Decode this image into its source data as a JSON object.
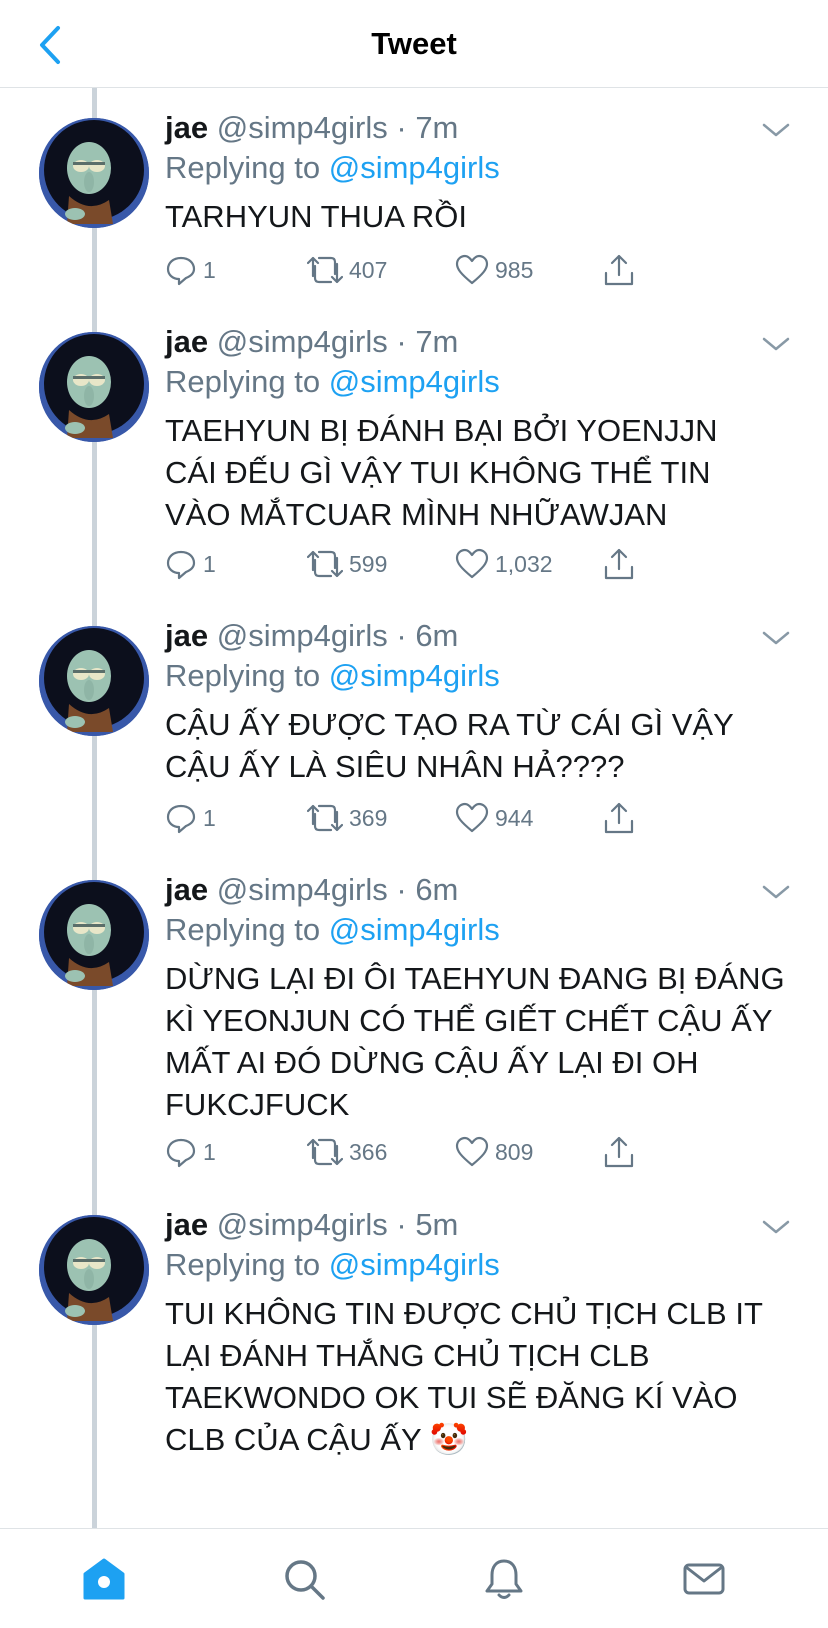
{
  "header": {
    "title": "Tweet"
  },
  "tweets": [
    {
      "name": "jae",
      "handle": "@simp4girls",
      "dot": "·",
      "time": "7m",
      "replying_prefix": "Replying to",
      "replying_to": "@simp4girls",
      "text_lines": [
        "TARHYUN THUA RỒI"
      ],
      "replies": "1",
      "retweets": "407",
      "likes": "985"
    },
    {
      "name": "jae",
      "handle": "@simp4girls",
      "dot": "·",
      "time": "7m",
      "replying_prefix": "Replying to",
      "replying_to": "@simp4girls",
      "text_lines": [
        "TAEHYUN BỊ ĐÁNH BẠI BỞI YOENJJN",
        "CÁI ĐẾU GÌ VẬY TUI KHÔNG THỂ TIN",
        "VÀO MẮTCUAR MÌNH NHỮAWJAN"
      ],
      "replies": "1",
      "retweets": "599",
      "likes": "1,032"
    },
    {
      "name": "jae",
      "handle": "@simp4girls",
      "dot": "·",
      "time": "6m",
      "replying_prefix": "Replying to",
      "replying_to": "@simp4girls",
      "text_lines": [
        "CẬU ẤY ĐƯỢC TẠO RA TỪ CÁI GÌ VẬY",
        "CẬU ẤY LÀ SIÊU NHÂN HẢ????"
      ],
      "replies": "1",
      "retweets": "369",
      "likes": "944"
    },
    {
      "name": "jae",
      "handle": "@simp4girls",
      "dot": "·",
      "time": "6m",
      "replying_prefix": "Replying to",
      "replying_to": "@simp4girls",
      "text_lines": [
        "DỪNG LẠI ĐI ÔI TAEHYUN ĐANG BỊ ĐÁNG",
        "KÌ YEONJUN CÓ THỂ GIẾT CHẾT CẬU ẤY",
        "MẤT AI ĐÓ DỪNG CẬU ẤY LẠI ĐI OH",
        "FUKCJFUCK"
      ],
      "replies": "1",
      "retweets": "366",
      "likes": "809"
    },
    {
      "name": "jae",
      "handle": "@simp4girls",
      "dot": "·",
      "time": "5m",
      "replying_prefix": "Replying to",
      "replying_to": "@simp4girls",
      "text_lines": [
        "TUI KHÔNG TIN ĐƯỢC CHỦ TỊCH CLB IT",
        "LẠI ĐÁNH THẮNG CHỦ TỊCH CLB",
        "TAEKWONDO OK TUI SẼ ĐĂNG KÍ VÀO",
        "CLB CỦA CẬU ẤY 🤡"
      ],
      "replies": "",
      "retweets": "",
      "likes": ""
    }
  ],
  "icons": {
    "back": "chevron-left-icon",
    "more": "chevron-down-icon",
    "reply": "comment-icon",
    "retweet": "retweet-icon",
    "like": "heart-icon",
    "share": "share-icon",
    "tabs": [
      "home-icon",
      "search-icon",
      "bell-icon",
      "mail-icon"
    ]
  },
  "colors": {
    "accent": "#1da1f2",
    "muted": "#657786",
    "text": "#14171a",
    "border": "#dfe3e6",
    "thread": "#cbd3da"
  }
}
